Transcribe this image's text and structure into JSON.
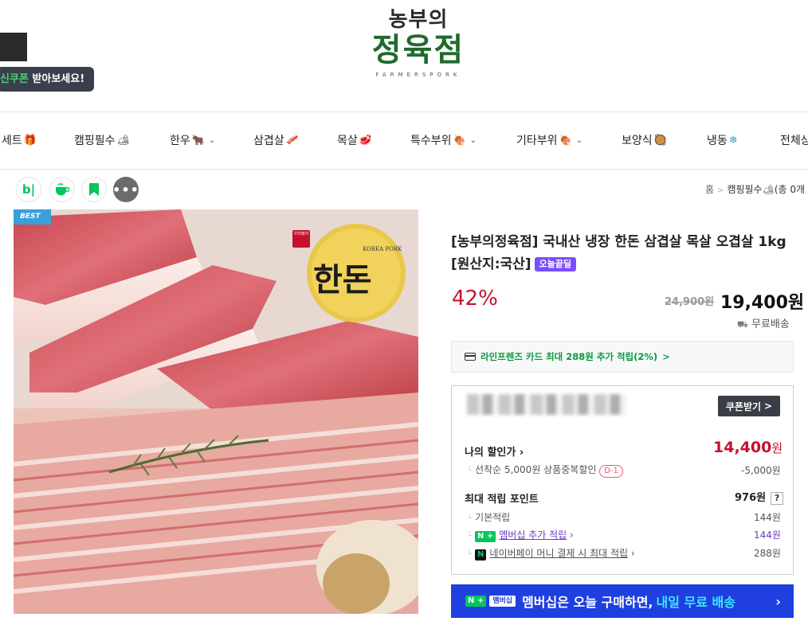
{
  "header": {
    "coupon_prefix": "신쿠폰",
    "coupon_text": " 받아보세요!",
    "logo_line1": "농부의",
    "logo_line2": "정육점",
    "logo_sub": "FARMERSPORK"
  },
  "nav": {
    "items": [
      {
        "label": "세트",
        "icon": "🎁",
        "chevron": false
      },
      {
        "label": "캠핑필수",
        "icon": "🏕",
        "chevron": false
      },
      {
        "label": "한우",
        "icon": "🐂",
        "chevron": true
      },
      {
        "label": "삼겹살",
        "icon": "🥓",
        "chevron": false
      },
      {
        "label": "목살",
        "icon": "🥩",
        "chevron": false
      },
      {
        "label": "특수부위",
        "icon": "🍖",
        "chevron": true
      },
      {
        "label": "기타부위",
        "icon": "🍖",
        "chevron": true
      },
      {
        "label": "보양식",
        "icon": "🥘",
        "chevron": false
      },
      {
        "label": "냉동",
        "icon": "❄",
        "chevron": false
      },
      {
        "label": "전체상",
        "icon": "",
        "chevron": false
      }
    ]
  },
  "share": {
    "blog_label": "b|",
    "more_label": "•••"
  },
  "breadcrumb": {
    "home": "홈",
    "category": "캠핑필수🏕(총 0개"
  },
  "image": {
    "badge": "BEST",
    "brand_small": "우리돼지",
    "brand_en": "KOREA PORK",
    "brand_ko": "한돈"
  },
  "product": {
    "title": "[농부의정육점] 국내산 냉장 한돈 삼겹살 목살 오겹살 1kg [원산지:국산]",
    "badge": "오늘끝딜",
    "discount": "42%",
    "original_price": "24,900원",
    "price": "19,400원",
    "shipping": "무료배송"
  },
  "card_promo": {
    "text": "라인프렌즈 카드 최대 288원 추가 적립(2%)",
    "arrow": ">"
  },
  "benefit": {
    "coupon_button": "쿠폰받기",
    "coupon_arrow": ">",
    "my_discount_label": "나의 할인가",
    "my_discount_price": "14,400",
    "my_discount_won": "원",
    "first_come_label": "선착순 5,000원 상품중복할인",
    "d_badge": "D-1",
    "first_come_amount": "-5,000원",
    "max_point_label": "최대 적립 포인트",
    "max_point_value": "976원",
    "qmark": "?",
    "basic_label": "기본적립",
    "basic_value": "144원",
    "membership_pill": "N +",
    "membership_label": "멤버십 추가 적립",
    "membership_value": "144원",
    "npay_pill": "N",
    "npay_label": "네이버페이 머니 결제 시 최대 적립",
    "npay_value": "288원"
  },
  "member_banner": {
    "pill": "N +",
    "tag": "멤버십",
    "text": "멤버십은 오늘 구매하면,",
    "highlight": "내일 무료 배송",
    "arrow": "›"
  },
  "colors": {
    "accent_red": "#c8102e",
    "naver_green": "#03c75a",
    "member_blue": "#1f3fe0",
    "today_purple": "#7b4dff"
  }
}
